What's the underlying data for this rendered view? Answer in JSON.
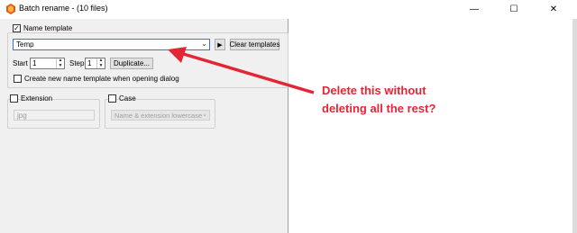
{
  "window": {
    "title": "Batch rename - (10 files)",
    "minimize_glyph": "—",
    "maximize_glyph": "☐",
    "close_glyph": "✕",
    "app_icon": "batch-rename-app-icon"
  },
  "name_template": {
    "checkbox_label": "Name template",
    "checked": true,
    "template_value": "Temp",
    "clear_button": "Clear templates",
    "play_glyph": "▶",
    "start_label": "Start",
    "start_value": "1",
    "step_label": "Step",
    "step_value": "1",
    "duplicate_button": "Duplicate...",
    "create_new_label": "Create new name template when opening dialog",
    "create_new_checked": false
  },
  "extension": {
    "checkbox_label": "Extension",
    "checked": false,
    "value": "jpg"
  },
  "case": {
    "checkbox_label": "Case",
    "checked": false,
    "selected": "Name & extension lowercase"
  },
  "annotation": {
    "line1": "Delete this without",
    "line2": "deleting all the rest?",
    "color": "#e32636"
  },
  "colors": {
    "panel_bg": "#f0f0f0",
    "focus_border": "#3a76c7"
  }
}
